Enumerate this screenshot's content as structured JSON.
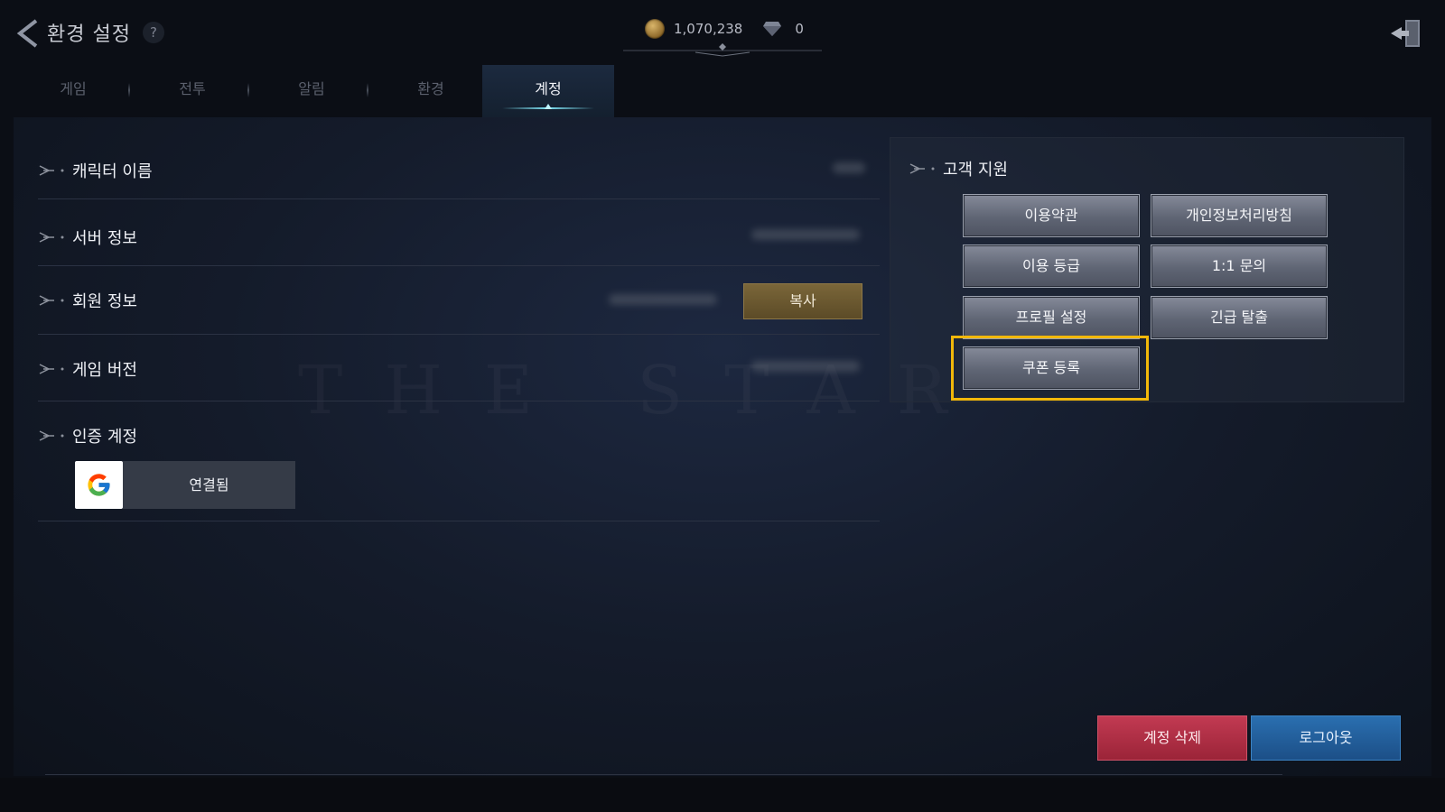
{
  "header": {
    "title": "환경 설정",
    "help": "?",
    "gold": "1,070,238",
    "gems": "0"
  },
  "tabs": [
    {
      "label": "게임"
    },
    {
      "label": "전투"
    },
    {
      "label": "알림"
    },
    {
      "label": "환경"
    },
    {
      "label": "계정"
    }
  ],
  "active_tab": "계정",
  "account": {
    "character_name": "캐릭터 이름",
    "server_info": "서버 정보",
    "member_info": "회원 정보",
    "copy": "복사",
    "game_version": "게임 버전",
    "auth_account": "인증 계정",
    "connected": "연결됨"
  },
  "support": {
    "title": "고객 지원",
    "buttons": [
      "이용약관",
      "개인정보처리방침",
      "이용 등급",
      "1:1 문의",
      "프로필 설정",
      "긴급 탈출",
      "쿠폰 등록"
    ]
  },
  "footer": {
    "delete_account": "계정 삭제",
    "logout": "로그아웃"
  },
  "colors": {
    "highlight": "#f2b80a",
    "delete": "#b32f46",
    "logout": "#235f9c",
    "copy": "#6b5830"
  },
  "icons": [
    "back-arrow-icon",
    "help-icon",
    "gold-coin-icon",
    "diamond-gem-icon",
    "exit-door-icon",
    "row-bullet-icon",
    "google-icon"
  ]
}
